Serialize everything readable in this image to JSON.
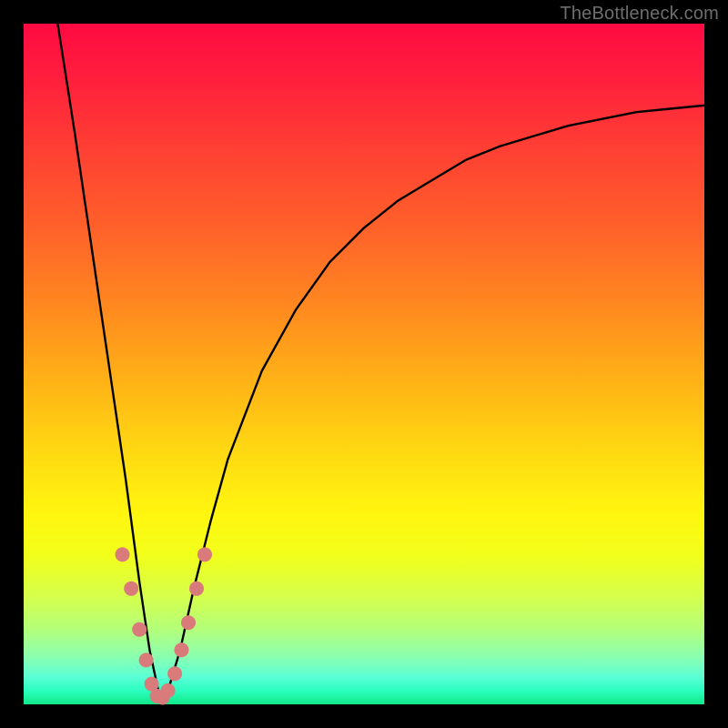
{
  "watermark": "TheBottleneck.com",
  "colors": {
    "frame": "#000000",
    "curve": "#000000",
    "marker_fill": "#d97b7b",
    "marker_stroke": "#b85a5a",
    "gradient_stops": [
      "#ff0a42",
      "#ff1f3d",
      "#ff3e34",
      "#ff612a",
      "#ff8a1f",
      "#ffb416",
      "#ffd912",
      "#fff60f",
      "#f2ff1a",
      "#d6ff4a",
      "#b3ff7a",
      "#8bffb0",
      "#5affd6",
      "#2bffbf",
      "#11e887"
    ]
  },
  "chart_data": {
    "type": "line",
    "title": "",
    "xlabel": "",
    "ylabel": "",
    "xlim": [
      0,
      100
    ],
    "ylim": [
      0,
      100
    ],
    "grid": false,
    "legend": false,
    "note": "Axes are implied (no ticks or labels rendered). Curve is a V/notch shape; y≈0 is optimal (green), y≈100 is worst (red). Minimum at roughly x≈20.",
    "series": [
      {
        "name": "bottleneck-curve",
        "x": [
          5,
          7.5,
          10,
          12.5,
          15,
          17,
          18.5,
          20,
          21.5,
          23,
          25,
          27.5,
          30,
          35,
          40,
          45,
          50,
          55,
          60,
          65,
          70,
          75,
          80,
          85,
          90,
          95,
          100
        ],
        "y": [
          100,
          84,
          67,
          50,
          33,
          18,
          8,
          1,
          3,
          8,
          17,
          27,
          36,
          49,
          58,
          65,
          70,
          74,
          77,
          80,
          82,
          83.5,
          85,
          86,
          87,
          87.5,
          88
        ]
      }
    ],
    "markers": {
      "name": "highlighted-points",
      "x": [
        14.5,
        15.8,
        17.0,
        18.0,
        18.8,
        19.6,
        20.4,
        21.2,
        22.2,
        23.2,
        24.2,
        25.4,
        26.6
      ],
      "y": [
        22.0,
        17.0,
        11.0,
        6.5,
        3.0,
        1.2,
        1.0,
        2.0,
        4.5,
        8.0,
        12.0,
        17.0,
        22.0
      ]
    }
  }
}
